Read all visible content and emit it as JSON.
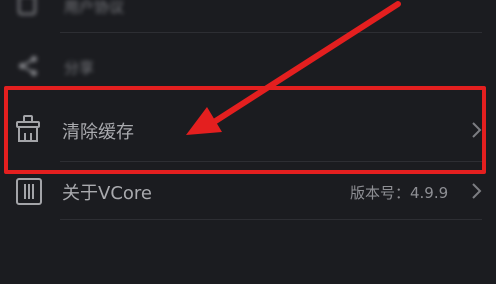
{
  "settings_list": {
    "items": [
      {
        "label": "用户协议",
        "value": "",
        "icon": "document-icon",
        "blurred": true
      },
      {
        "label": "分享",
        "value": "",
        "icon": "share-icon",
        "blurred": true
      },
      {
        "label": "清除缓存",
        "value": "",
        "icon": "broom-icon",
        "blurred": false
      },
      {
        "label": "关于VCore",
        "value": "版本号：4.9.9",
        "icon": "trash-bin-icon",
        "blurred": false
      }
    ]
  },
  "annotation": {
    "color": "#e41f1f",
    "highlighted_item": "清除缓存"
  }
}
